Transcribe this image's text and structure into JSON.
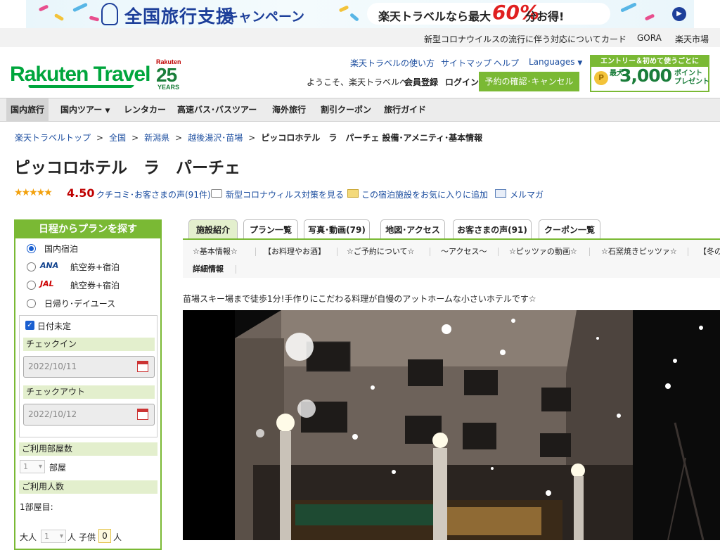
{
  "banner": {
    "title": "全国旅行支援",
    "subtitle": "キャンペーン",
    "pill_a": "楽天トラベルなら最大",
    "pill_b": "60%",
    "pill_c": "分お得!"
  },
  "topbar": {
    "items": [
      "新型コロナウイルスの流行に伴う対応について",
      "カード",
      "GORA",
      "楽天市場"
    ]
  },
  "header": {
    "logo": "Rakuten Travel",
    "anniv_brand": "Rakuten",
    "anniv_num": "25",
    "anniv_years": "YEARS",
    "links": [
      "楽天トラベルの使い方",
      "サイトマップ",
      "ヘルプ",
      "Languages"
    ],
    "welcome": "ようこそ、楽天トラベルへ",
    "register": "会員登録",
    "login": "ログイン",
    "reserve_btn": "予約の確認･キャンセル",
    "promo": {
      "title": "エントリー＆初めて使うごとに",
      "coin": "P",
      "max": "最大",
      "value": "3,000",
      "points": "ポイント\nプレゼント"
    }
  },
  "nav": {
    "items": [
      "国内旅行",
      "国内ツアー",
      "レンタカー",
      "高速バス･バスツアー",
      "海外旅行",
      "割引クーポン",
      "旅行ガイド"
    ]
  },
  "breadcrumb": {
    "items": [
      "楽天トラベルトップ",
      "全国",
      "新潟県",
      "越後湯沢･苗場"
    ],
    "separator": ">",
    "current": "ピッコロホテル　ラ　パーチェ 設備･アメニティ･基本情報"
  },
  "hotel": {
    "name": "ピッコロホテル　ラ　パーチェ",
    "stars": "★★★★★",
    "score": "4.50",
    "review_link": "クチコミ･お客さまの声(91件)",
    "covid_link": "新型コロナウィルス対策を見る",
    "favorite_link": "この宿泊施設をお気に入りに追加",
    "mailmag_link": "メルマガ"
  },
  "sidebar": {
    "title": "日程からプランを探す",
    "options": [
      {
        "label": "国内宿泊",
        "selected": true
      },
      {
        "label": "航空券+宿泊",
        "airline": "ANA"
      },
      {
        "label": "航空券+宿泊",
        "airline": "JAL"
      },
      {
        "label": "日帰り･デイユース"
      }
    ],
    "undecided": "日付未定",
    "checkin_label": "チェックイン",
    "checkin_value": "2022/10/11",
    "checkout_label": "チェックアウト",
    "checkout_value": "2022/10/12",
    "rooms_label": "ご利用部屋数",
    "rooms_value": "1",
    "rooms_unit": "部屋",
    "guests_label": "ご利用人数",
    "room1": "1部屋目:",
    "adult_label": "大人",
    "adult_value": "1",
    "adult_unit": "人",
    "child_label": "子供",
    "child_value": "0",
    "child_unit": "人"
  },
  "tabs": [
    "施設紹介",
    "プラン一覧",
    "写真･動画(79)",
    "地図･アクセス",
    "お客さまの声(91)",
    "クーポン一覧"
  ],
  "subnav": [
    "☆基本情報☆",
    "【お料理やお酒】",
    "☆ご予約について☆",
    "～アクセス～",
    "☆ピッツァの動画☆",
    "☆石窯焼きピッツァ☆",
    "【冬の",
    "詳細情報"
  ],
  "intro": "苗場スキー場まで徒歩1分!手作りにこだわる料理が自慢のアットホームな小さいホテルです☆",
  "colors": {
    "brand_green": "#00a63d",
    "accent_green": "#7ab934",
    "link_blue": "#1e4fa0",
    "rating_red": "#bf0000"
  }
}
